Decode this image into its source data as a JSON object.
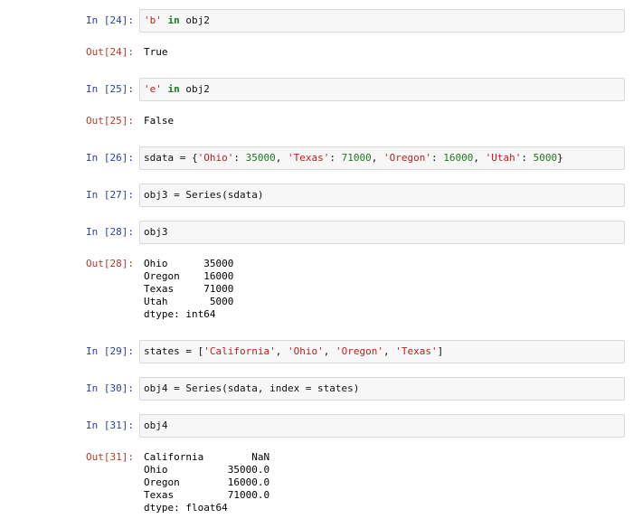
{
  "cells": {
    "c24": {
      "in_prompt": "In [24]:",
      "code": {
        "s1": "'b'",
        "kw": "in",
        "rest": " obj2"
      },
      "out_prompt": "Out[24]:",
      "output": "True"
    },
    "c25": {
      "in_prompt": "In [25]:",
      "code": {
        "s1": "'e'",
        "kw": "in",
        "rest": " obj2"
      },
      "out_prompt": "Out[25]:",
      "output": "False"
    },
    "c26": {
      "in_prompt": "In [26]:",
      "code": {
        "p0": "sdata = {",
        "k1": "'Ohio'",
        "v1": "35000",
        "k2": "'Texas'",
        "v2": "71000",
        "k3": "'Oregon'",
        "v3": "16000",
        "k4": "'Utah'",
        "v4": "5000",
        "sep": ": ",
        "comma": ", ",
        "close": "}"
      }
    },
    "c27": {
      "in_prompt": "In [27]:",
      "code": "obj3 = Series(sdata)"
    },
    "c28": {
      "in_prompt": "In [28]:",
      "code": "obj3",
      "out_prompt": "Out[28]:",
      "output": "Ohio      35000\nOregon    16000\nTexas     71000\nUtah       5000\ndtype: int64"
    },
    "c29": {
      "in_prompt": "In [29]:",
      "code": {
        "p0": "states = [",
        "s1": "'California'",
        "s2": "'Ohio'",
        "s3": "'Oregon'",
        "s4": "'Texas'",
        "comma": ", ",
        "close": "]"
      }
    },
    "c30": {
      "in_prompt": "In [30]:",
      "code": "obj4 = Series(sdata, index = states)"
    },
    "c31": {
      "in_prompt": "In [31]:",
      "code": "obj4",
      "out_prompt": "Out[31]:",
      "output": "California        NaN\nOhio          35000.0\nOregon        16000.0\nTexas         71000.0\ndtype: float64"
    }
  }
}
